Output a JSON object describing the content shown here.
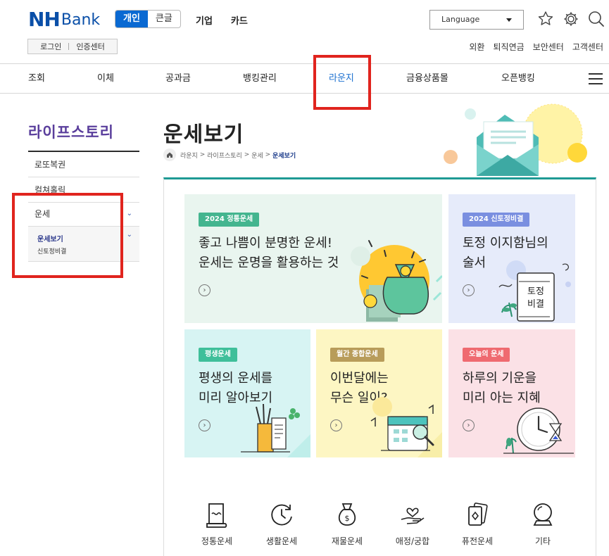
{
  "brand": {
    "nh": "NH",
    "bank": "Bank"
  },
  "segments": [
    {
      "label": "개인",
      "active": true
    },
    {
      "label": "큰글",
      "active": false
    }
  ],
  "top_nav": [
    "기업",
    "카드"
  ],
  "language": {
    "label": "Language"
  },
  "auth": {
    "login": "로그인",
    "cert": "인증센터"
  },
  "utility_links": [
    "외환",
    "퇴직연금",
    "보안센터",
    "고객센터"
  ],
  "gnb": [
    {
      "label": "조회"
    },
    {
      "label": "이체"
    },
    {
      "label": "공과금"
    },
    {
      "label": "뱅킹관리"
    },
    {
      "label": "라운지",
      "active": true
    },
    {
      "label": "금융상품몰"
    },
    {
      "label": "오픈뱅킹"
    }
  ],
  "lnb": {
    "title": "라이프스토리",
    "items": [
      "로또복권",
      "컬쳐홀릭",
      "운세"
    ],
    "sub_items": [
      "운세보기",
      "신토정비결"
    ]
  },
  "page": {
    "title": "운세보기",
    "breadcrumb": {
      "items": [
        "라운지",
        "라이프스토리",
        "운세"
      ],
      "current": "운세보기",
      "sep": ">"
    }
  },
  "cards": [
    {
      "badge": "2024 정통운세",
      "text": "좋고 나쁨이 분명한 운세!\n운세는 운명을 활용하는 것",
      "badge_color": "#44b58f",
      "bg": "#e9f5ef"
    },
    {
      "badge": "2024 신토정비결",
      "text": "토정 이지함님의\n술서",
      "badge_color": "#7a8fe0",
      "bg": "#e6ebfa",
      "art_label": "토정\n비결"
    },
    {
      "badge": "평생운세",
      "text": "평생의 운세를\n미리 알아보기",
      "badge_color": "#3fbf9a",
      "bg": "#d7f4f3"
    },
    {
      "badge": "월간 종합운세",
      "text": "이번달에는\n무슨 일이?",
      "badge_color": "#b89c5a",
      "bg": "#fdf6c3"
    },
    {
      "badge": "오늘의 운세",
      "text": "하루의 기운을\n미리 아는 지혜",
      "badge_color": "#ef6a70",
      "bg": "#fbe1e6"
    }
  ],
  "categories": [
    {
      "label": "정통운세",
      "icon": "scroll-icon"
    },
    {
      "label": "생활운세",
      "icon": "refresh-clock-icon"
    },
    {
      "label": "재물운세",
      "icon": "money-bag-icon"
    },
    {
      "label": "애정/궁합",
      "icon": "heart-hand-icon"
    },
    {
      "label": "퓨전운세",
      "icon": "cards-icon"
    },
    {
      "label": "기타",
      "icon": "crystal-ball-icon"
    }
  ],
  "colors": {
    "brand_blue": "#0a4fa8",
    "active_blue": "#1a6fd0",
    "lnb_purple": "#5a3e9c",
    "panel_teal": "#1f9a94",
    "highlight_red": "#e0241e"
  }
}
